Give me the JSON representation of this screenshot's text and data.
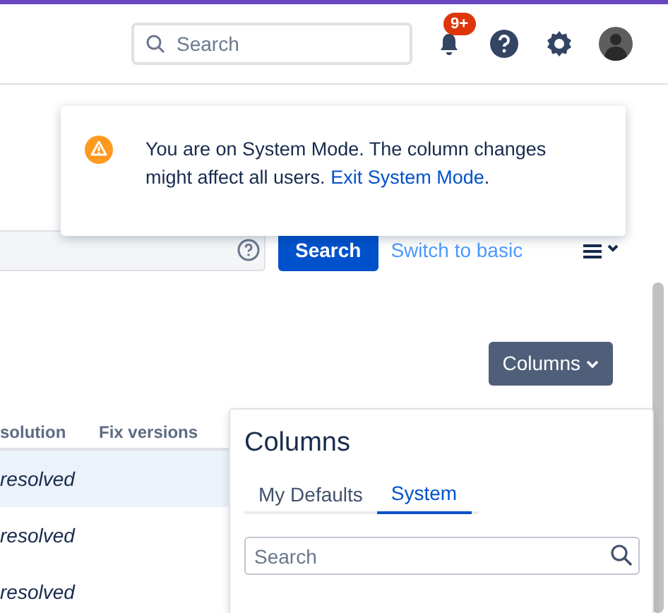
{
  "header": {
    "search": {
      "placeholder": "Search"
    },
    "notifications": {
      "badge": "9+"
    }
  },
  "flag": {
    "message": "You are on System Mode. The column changes might affect all users.",
    "link": "Exit System Mode",
    "suffix": "."
  },
  "query_bar": {
    "search_button": "Search",
    "switch_link": "Switch to basic"
  },
  "columns_button": "Columns",
  "table": {
    "columns": [
      "solution",
      "Fix versions"
    ],
    "rows": [
      {
        "cells": [
          "resolved"
        ],
        "selected": true
      },
      {
        "cells": [
          "resolved"
        ],
        "selected": false
      },
      {
        "cells": [
          "resolved"
        ],
        "selected": false
      }
    ]
  },
  "columns_popup": {
    "title": "Columns",
    "tabs": [
      {
        "label": "My Defaults",
        "selected": false
      },
      {
        "label": "System",
        "selected": true
      }
    ],
    "search": {
      "placeholder": "Search"
    }
  }
}
